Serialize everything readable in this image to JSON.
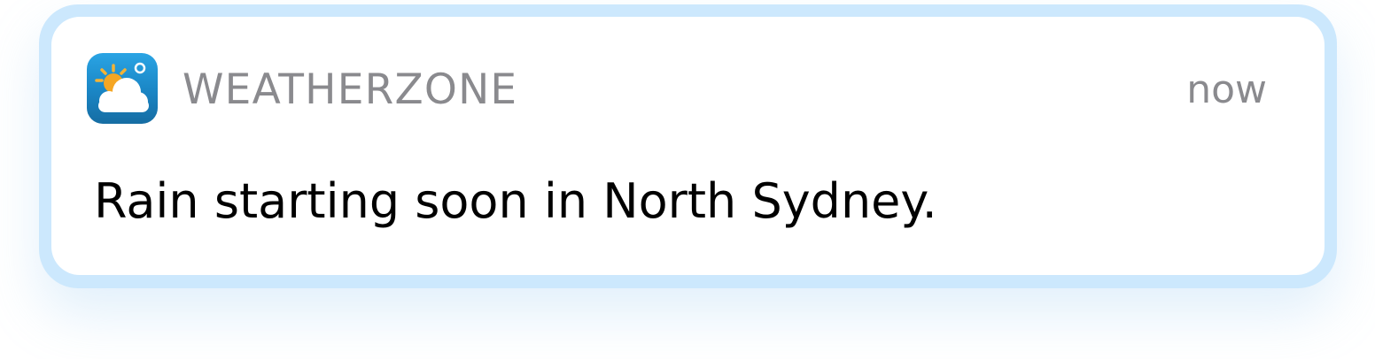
{
  "notification": {
    "app_name": "WEATHERZONE",
    "app_icon": "weather-sun-cloud-icon",
    "timestamp": "now",
    "message": "Rain starting soon in North Sydney."
  },
  "colors": {
    "card_border": "#cce8fd",
    "card_background": "#ffffff",
    "secondary_text": "#8a8a8e",
    "primary_text": "#000000",
    "icon_background": "#1a85c4",
    "sun": "#f5a623",
    "cloud": "#ffffff"
  }
}
